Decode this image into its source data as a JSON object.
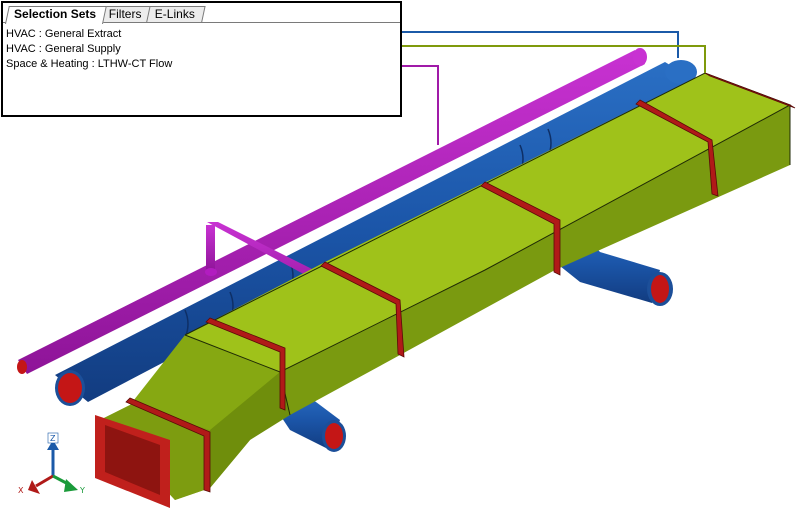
{
  "panel": {
    "tabs": [
      {
        "label": "Selection Sets",
        "active": true
      },
      {
        "label": "Filters",
        "active": false
      },
      {
        "label": "E-Links",
        "active": false
      }
    ],
    "selection_sets": [
      {
        "label": "HVAC : General Extract",
        "color": "#1b5aa8"
      },
      {
        "label": "HVAC : General Supply",
        "color": "#7f9a0c"
      },
      {
        "label": "Space & Heating : LTHW-CT Flow",
        "color": "#a01aa8"
      }
    ]
  },
  "axes": {
    "z": "Z",
    "x": "X",
    "y": "Y"
  },
  "colors": {
    "extract_duct": "#1b5aa8",
    "supply_duct": "#86a812",
    "heating_pipe": "#b21cc0",
    "flange": "#b01a18",
    "background": "#ffffff"
  }
}
